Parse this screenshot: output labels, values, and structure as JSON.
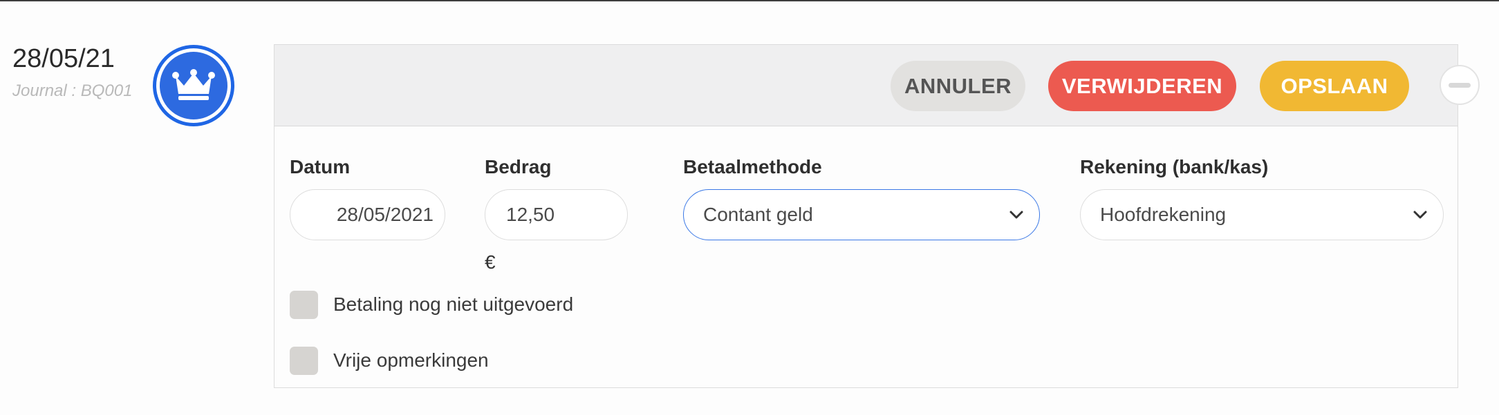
{
  "entry": {
    "date": "28/05/21",
    "journal": "Journal : BQ001",
    "badge_icon": "crown-icon",
    "badge_color": "#2d6ae0"
  },
  "toolbar": {
    "cancel_label": "ANNULER",
    "delete_label": "VERWIJDEREN",
    "save_label": "OPSLAAN",
    "collapse_icon": "minus-icon",
    "colors": {
      "cancel": "#e2e1df",
      "delete": "#ec5a50",
      "save": "#f1b833"
    }
  },
  "form": {
    "date": {
      "label": "Datum",
      "value": "28/05/2021"
    },
    "amount": {
      "label": "Bedrag",
      "value": "12,50",
      "currency": "€"
    },
    "payment_method": {
      "label": "Betaalmethode",
      "value": "Contant geld"
    },
    "account": {
      "label": "Rekening (bank/kas)",
      "value": "Hoofdrekening"
    },
    "not_executed": {
      "label": "Betaling nog niet uitgevoerd",
      "checked": false
    },
    "free_remarks": {
      "label": "Vrije opmerkingen",
      "checked": false
    }
  }
}
